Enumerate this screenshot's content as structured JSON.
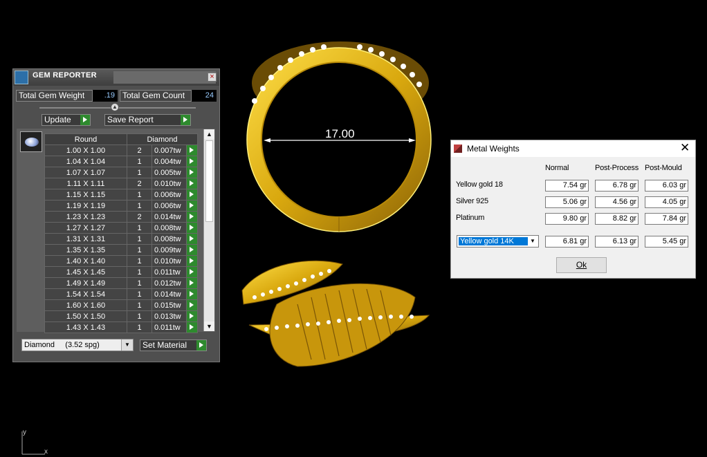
{
  "gem_reporter": {
    "title": "GEM REPORTER",
    "total_weight_label": "Total Gem Weight",
    "total_weight_value": ".19",
    "total_count_label": "Total Gem Count",
    "total_count_value": "24",
    "update_label": "Update",
    "save_report_label": "Save Report",
    "columns": [
      "Round",
      "Diamond"
    ],
    "rows": [
      {
        "size": "1.00 X 1.00",
        "count": "2",
        "weight": "0.007tw"
      },
      {
        "size": "1.04 X 1.04",
        "count": "1",
        "weight": "0.004tw"
      },
      {
        "size": "1.07 X 1.07",
        "count": "1",
        "weight": "0.005tw"
      },
      {
        "size": "1.11 X 1.11",
        "count": "2",
        "weight": "0.010tw"
      },
      {
        "size": "1.15 X 1.15",
        "count": "1",
        "weight": "0.006tw"
      },
      {
        "size": "1.19 X 1.19",
        "count": "1",
        "weight": "0.006tw"
      },
      {
        "size": "1.23 X 1.23",
        "count": "2",
        "weight": "0.014tw"
      },
      {
        "size": "1.27 X 1.27",
        "count": "1",
        "weight": "0.008tw"
      },
      {
        "size": "1.31 X 1.31",
        "count": "1",
        "weight": "0.008tw"
      },
      {
        "size": "1.35 X 1.35",
        "count": "1",
        "weight": "0.009tw"
      },
      {
        "size": "1.40 X 1.40",
        "count": "1",
        "weight": "0.010tw"
      },
      {
        "size": "1.45 X 1.45",
        "count": "1",
        "weight": "0.011tw"
      },
      {
        "size": "1.49 X 1.49",
        "count": "1",
        "weight": "0.012tw"
      },
      {
        "size": "1.54 X 1.54",
        "count": "1",
        "weight": "0.014tw"
      },
      {
        "size": "1.60 X 1.60",
        "count": "1",
        "weight": "0.015tw"
      },
      {
        "size": "1.50 X 1.50",
        "count": "1",
        "weight": "0.013tw"
      },
      {
        "size": "1.43 X 1.43",
        "count": "1",
        "weight": "0.011tw"
      }
    ],
    "material_select": "Diamond     (3.52 spg)",
    "set_material_label": "Set Material"
  },
  "viewport": {
    "dimension_label": "17.00",
    "axis_x": "x",
    "axis_y": "y"
  },
  "metal_weights": {
    "title": "Metal Weights",
    "headers": [
      "Normal",
      "Post-Process",
      "Post-Mould"
    ],
    "rows": [
      {
        "label": "Yellow gold 18",
        "values": [
          "7.54 gr",
          "6.78 gr",
          "6.03 gr"
        ]
      },
      {
        "label": "Silver 925",
        "values": [
          "5.06 gr",
          "4.56 gr",
          "4.05 gr"
        ]
      },
      {
        "label": "Platinum",
        "values": [
          "9.80 gr",
          "8.82 gr",
          "7.84 gr"
        ]
      }
    ],
    "custom_select": "Yellow gold 14K",
    "custom_values": [
      "6.81 gr",
      "6.13 gr",
      "5.45 gr"
    ],
    "ok_label": "Ok"
  },
  "colors": {
    "gold": "#d4a20c",
    "panel": "#4f4f4f",
    "play_green": "#2e8a2e"
  }
}
